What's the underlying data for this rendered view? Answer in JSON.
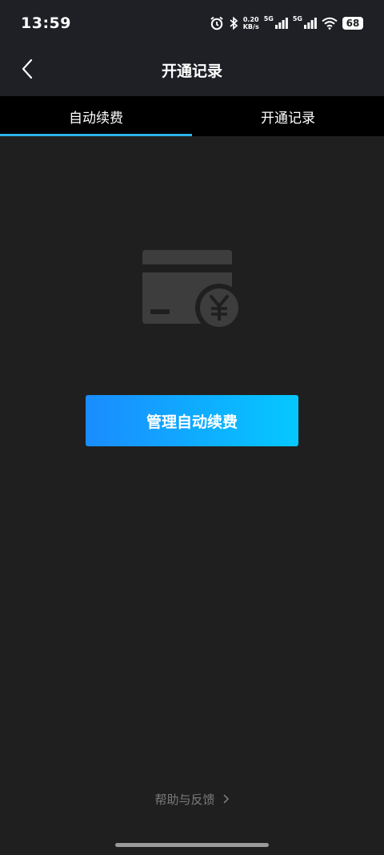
{
  "status_bar": {
    "time": "13:59",
    "net_speed_value": "0.20",
    "net_speed_unit": "KB/s",
    "signal_1_label": "5G",
    "signal_2_label": "5G",
    "battery": "68",
    "icons": [
      "alarm-icon",
      "bluetooth-icon",
      "signal-icon",
      "signal-icon",
      "wifi-icon",
      "battery-icon"
    ]
  },
  "header": {
    "title": "开通记录",
    "back_icon": "chevron-left-icon"
  },
  "tabs": [
    {
      "label": "自动续费",
      "active": true
    },
    {
      "label": "开通记录",
      "active": false
    }
  ],
  "empty_state": {
    "icon": "card-yen-icon"
  },
  "actions": {
    "manage_label": "管理自动续费"
  },
  "footer": {
    "help_label": "帮助与反馈",
    "help_icon": "chevron-right-icon"
  },
  "colors": {
    "background": "#1f1f1f",
    "header_bg": "#1f2026",
    "tab_bg": "#000000",
    "accent": "#2bb4e8",
    "button_gradient_start": "#1a8cff",
    "button_gradient_end": "#05c8ff"
  }
}
